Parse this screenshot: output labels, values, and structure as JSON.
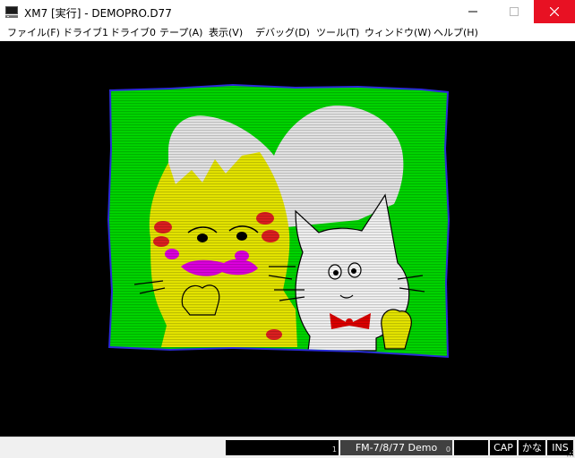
{
  "window": {
    "title": "XM7 [実行] - DEMOPRO.D77",
    "app_icon": "computer-icon",
    "controls": {
      "minimize": "minimize-icon",
      "maximize": "maximize-icon",
      "close": "close-icon"
    }
  },
  "menu": {
    "items": [
      {
        "label": "ファイル(F)"
      },
      {
        "label": "ドライブ1"
      },
      {
        "label": "ドライブ0"
      },
      {
        "label": "テープ(A)"
      },
      {
        "label": "表示(V)"
      },
      {
        "label": "デバッグ(D)"
      },
      {
        "label": "ツール(T)"
      },
      {
        "label": "ウィンドウ(W)"
      },
      {
        "label": "ヘルプ(H)"
      }
    ]
  },
  "screen": {
    "content": "emulated-display-image",
    "colors": {
      "background": "#000000",
      "border": "#2a2ad8",
      "green": "#00d800",
      "white": "#ffffff",
      "yellow": "#e8e800",
      "red": "#e00000",
      "magenta": "#e000e0"
    }
  },
  "status": {
    "drive1_text": "",
    "drive1_num": "1",
    "drive0_text": "FM-7/8/77 Demo",
    "drive0_num": "0",
    "blank": "",
    "cap": "CAP",
    "kana": "かな",
    "ins": "INS"
  }
}
